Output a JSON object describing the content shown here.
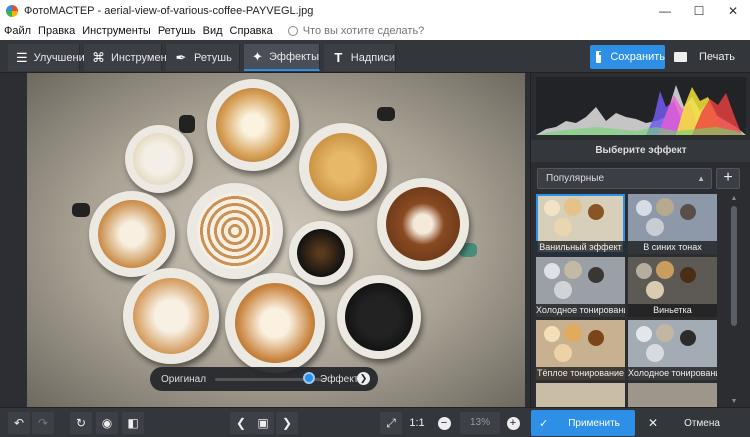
{
  "window": {
    "title": "ФотоМАСТЕР - aerial-view-of-various-coffee-PAYVEGL.jpg",
    "controls": [
      "minimize-icon",
      "maximize-icon",
      "close-icon"
    ]
  },
  "menu": {
    "items": [
      "Файл",
      "Правка",
      "Инструменты",
      "Ретушь",
      "Вид",
      "Справка"
    ],
    "search_placeholder": "Что вы хотите сделать?"
  },
  "toolbar": {
    "tabs": [
      {
        "label": "Улучшения",
        "icon": "sliders-icon"
      },
      {
        "label": "Инструменты",
        "icon": "crop-icon"
      },
      {
        "label": "Ретушь",
        "icon": "brush-icon"
      },
      {
        "label": "Эффекты",
        "icon": "magic-wand-icon",
        "active": true
      },
      {
        "label": "Надписи",
        "icon": "text-icon"
      }
    ],
    "save_label": "Сохранить",
    "print_label": "Печать"
  },
  "compare": {
    "original_label": "Оригинал",
    "effect_label": "Эффект",
    "position": 0.85
  },
  "panel": {
    "heading": "Выберите эффект",
    "category": "Популярные",
    "effects": [
      {
        "label": "Ванильный эффект",
        "selected": true
      },
      {
        "label": "В синих тонах"
      },
      {
        "label": "Холодное тонирование"
      },
      {
        "label": "Виньетка"
      },
      {
        "label": "Тёплое тонирование"
      },
      {
        "label": "Холодное тонирование"
      }
    ]
  },
  "bottom": {
    "zoom_fit": "1:1",
    "zoom_value": "13%",
    "apply_label": "Применить",
    "cancel_label": "Отмена"
  },
  "colors": {
    "accent": "#2d8fe5",
    "background": "#2b2d31"
  }
}
